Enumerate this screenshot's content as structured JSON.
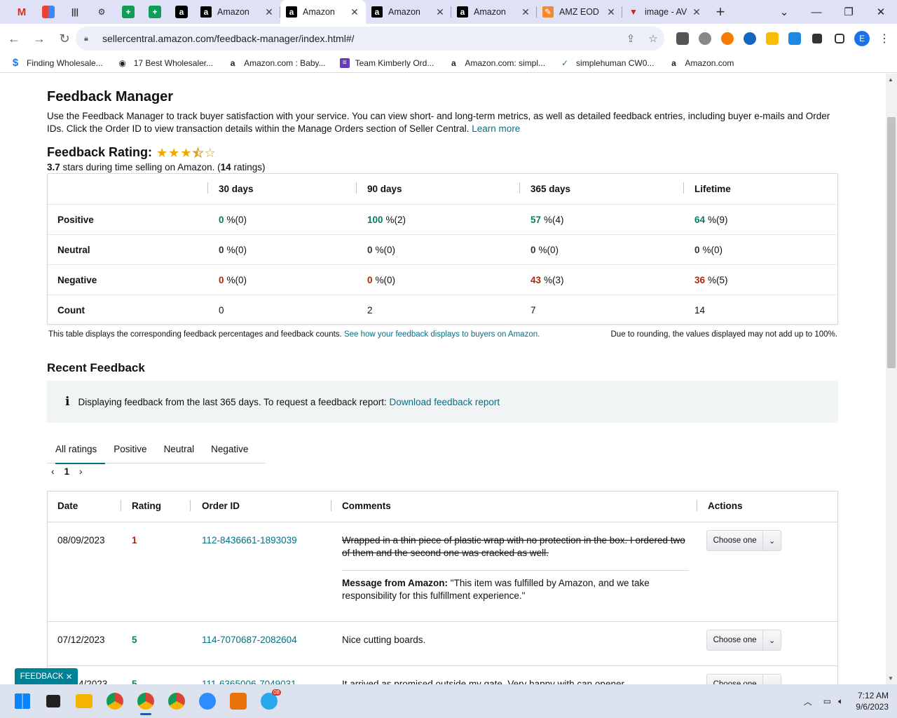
{
  "browser": {
    "tabs": [
      {
        "title": "Amazon",
        "active": false
      },
      {
        "title": "Amazon",
        "active": true
      },
      {
        "title": "Amazon",
        "active": false
      },
      {
        "title": "Amazon",
        "active": false
      },
      {
        "title": "AMZ EOD",
        "active": false
      },
      {
        "title": "image - AV",
        "active": false
      }
    ],
    "url": "sellercentral.amazon.com/feedback-manager/index.html#/",
    "profile_initial": "E",
    "bookmarks": [
      {
        "label": "Finding Wholesale...",
        "icon": "dollar-icon"
      },
      {
        "label": "17 Best Wholesaler...",
        "icon": "globe-icon"
      },
      {
        "label": "Amazon.com : Baby...",
        "icon": "amazon-icon"
      },
      {
        "label": "Team Kimberly Ord...",
        "icon": "forms-icon"
      },
      {
        "label": "Amazon.com: simpl...",
        "icon": "amazon-icon"
      },
      {
        "label": "simplehuman CW0...",
        "icon": "check-icon"
      },
      {
        "label": "Amazon.com",
        "icon": "amazon-icon"
      }
    ]
  },
  "page": {
    "title": "Feedback Manager",
    "intro": "Use the Feedback Manager to track buyer satisfaction with your service. You can view short- and long-term metrics, as well as detailed feedback entries, including buyer e-mails and Order IDs. Click the Order ID to view transaction details within the Manage Orders section of Seller Central.",
    "learn_more": "Learn more",
    "rating_label": "Feedback Rating:",
    "stars_value": 3.5,
    "rating_score": "3.7",
    "rating_sub_mid": "stars during time selling on Amazon. (",
    "rating_count": "14",
    "rating_sub_end": "ratings)"
  },
  "metrics": {
    "columns": [
      "30 days",
      "90 days",
      "365 days",
      "Lifetime"
    ],
    "rows": [
      {
        "label": "Positive",
        "kind": "pos",
        "cells": [
          [
            "0",
            "%(0)"
          ],
          [
            "100",
            "%(2)"
          ],
          [
            "57",
            "%(4)"
          ],
          [
            "64",
            "%(9)"
          ]
        ]
      },
      {
        "label": "Neutral",
        "kind": "neu",
        "cells": [
          [
            "0",
            "%(0)"
          ],
          [
            "0",
            "%(0)"
          ],
          [
            "0",
            "%(0)"
          ],
          [
            "0",
            "%(0)"
          ]
        ]
      },
      {
        "label": "Negative",
        "kind": "neg",
        "cells": [
          [
            "0",
            "%(0)"
          ],
          [
            "0",
            "%(0)"
          ],
          [
            "43",
            "%(3)"
          ],
          [
            "36",
            "%(5)"
          ]
        ]
      },
      {
        "label": "Count",
        "kind": "count",
        "cells": [
          [
            "0",
            ""
          ],
          [
            "2",
            ""
          ],
          [
            "7",
            ""
          ],
          [
            "14",
            ""
          ]
        ]
      }
    ],
    "note": "This table displays the corresponding feedback percentages and feedback counts.",
    "note_link": "See how your feedback displays to buyers on Amazon.",
    "rounding_note": "Due to rounding, the values displayed may not add up to 100%."
  },
  "recent": {
    "title": "Recent Feedback",
    "info_text": "Displaying feedback from the last 365 days. To request a feedback report:",
    "info_link": "Download feedback report",
    "tabs": [
      "All ratings",
      "Positive",
      "Neutral",
      "Negative"
    ],
    "page": "1",
    "columns": [
      "Date",
      "Rating",
      "Order ID",
      "Comments",
      "Actions"
    ],
    "action_label": "Choose one",
    "rows": [
      {
        "date": "08/09/2023",
        "rating": "1",
        "order_id": "112-8436661-1893039",
        "comment": "Wrapped in a thin piece of plastic wrap with no protection in the box. I ordered two of them and the second one was cracked as well.",
        "message_label": "Message from Amazon:",
        "message": "\"This item was fulfilled by Amazon, and we take responsibility for this fulfillment experience.\""
      },
      {
        "date": "07/12/2023",
        "rating": "5",
        "order_id": "114-7070687-2082604",
        "comment": "Nice cutting boards."
      },
      {
        "date": "4/2023",
        "rating": "5",
        "order_id": "111-6365006-7049031",
        "comment": "It arrived as promised outside my gate. Very happy with can opener."
      }
    ]
  },
  "feedback_pill": "FEEDBACK",
  "taskbar": {
    "time": "7:12 AM",
    "date": "9/6/2023",
    "telegram_badge": "08"
  }
}
